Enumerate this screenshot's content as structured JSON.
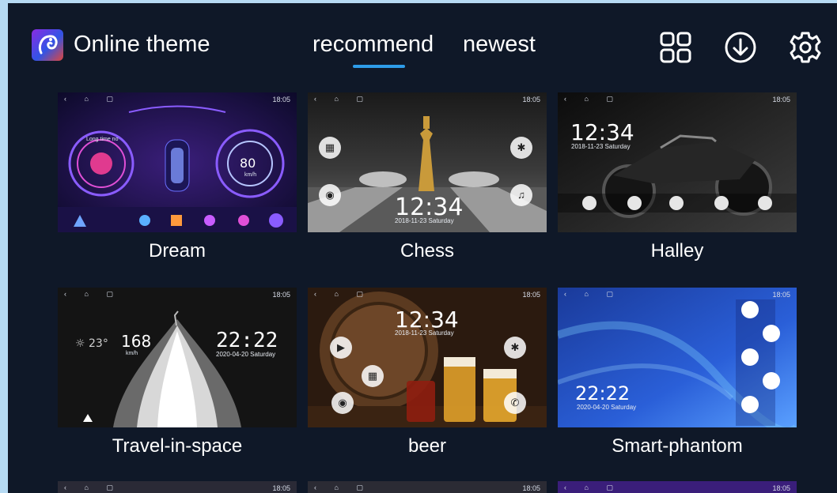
{
  "header": {
    "title": "Online theme",
    "tabs": [
      {
        "label": "recommend",
        "active": true
      },
      {
        "label": "newest",
        "active": false
      }
    ],
    "icons": [
      "grid-icon",
      "download-icon",
      "settings-icon"
    ]
  },
  "colors": {
    "background": "#0f1828",
    "frame": "#b6daf3",
    "accent": "#2e9ce8",
    "text": "#ffffff"
  },
  "status_time": "18:05",
  "themes": [
    {
      "label": "Dream",
      "left_text": "Long time no",
      "speed": "80",
      "speed_unit": "km/h"
    },
    {
      "label": "Chess",
      "clock": "12:34",
      "date": "2018-11-23 Saturday"
    },
    {
      "label": "Halley",
      "clock": "12:34",
      "date": "2018-11-23 Saturday"
    },
    {
      "label": "Travel-in-space",
      "temp": "23°",
      "speed": "168",
      "speed_unit": "km/h",
      "clock": "22:22",
      "date": "2020-04-20  Saturday"
    },
    {
      "label": "beer",
      "clock": "12:34",
      "date": "2018-11-23 Saturday"
    },
    {
      "label": "Smart-phantom",
      "clock": "22:22",
      "date": "2020-04-20 Saturday"
    }
  ]
}
